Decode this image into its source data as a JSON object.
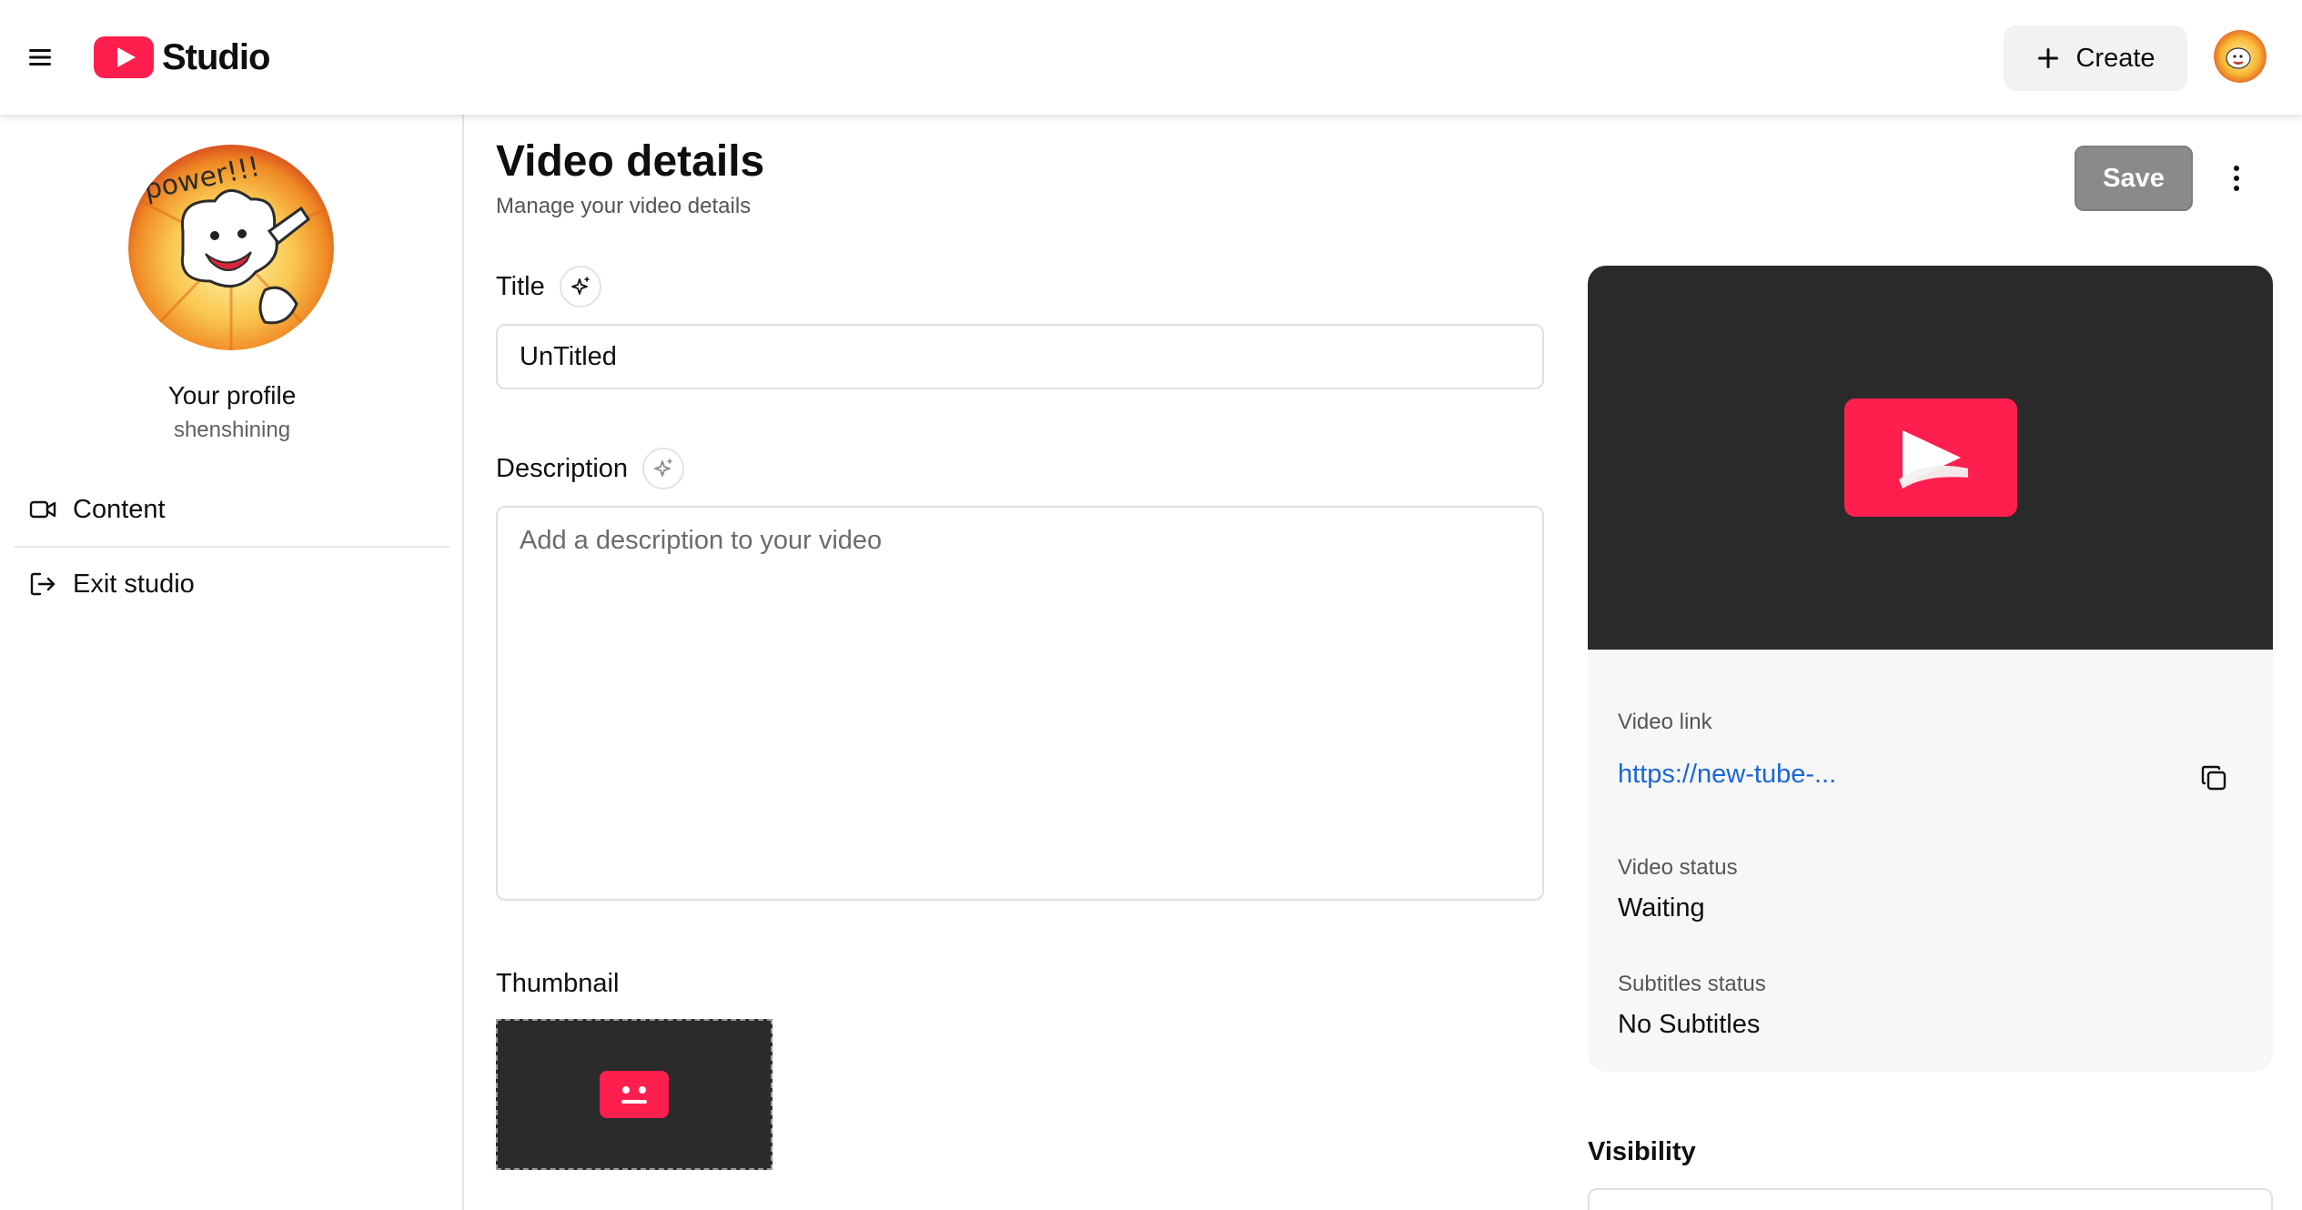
{
  "header": {
    "app_name": "Studio",
    "create_label": "Create"
  },
  "sidebar": {
    "profile_title": "Your profile",
    "profile_username": "shenshining",
    "items": [
      {
        "label": "Content",
        "icon": "video-camera-icon"
      },
      {
        "label": "Exit studio",
        "icon": "log-out-icon"
      }
    ]
  },
  "page": {
    "title": "Video details",
    "subtitle": "Manage your video details",
    "save_label": "Save"
  },
  "form": {
    "title_label": "Title",
    "title_value": "UnTitled",
    "description_label": "Description",
    "description_placeholder": "Add a description to your video",
    "thumbnail_label": "Thumbnail"
  },
  "video_card": {
    "link_label": "Video link",
    "link_value": "https://new-tube-...",
    "status_label": "Video status",
    "status_value": "Waiting",
    "subtitles_label": "Subtitles status",
    "subtitles_value": "No Subtitles"
  },
  "visibility": {
    "label": "Visibility"
  },
  "colors": {
    "brand": "#ff1f4f",
    "link": "#1a66d9",
    "save_disabled": "#8a8a8a"
  }
}
